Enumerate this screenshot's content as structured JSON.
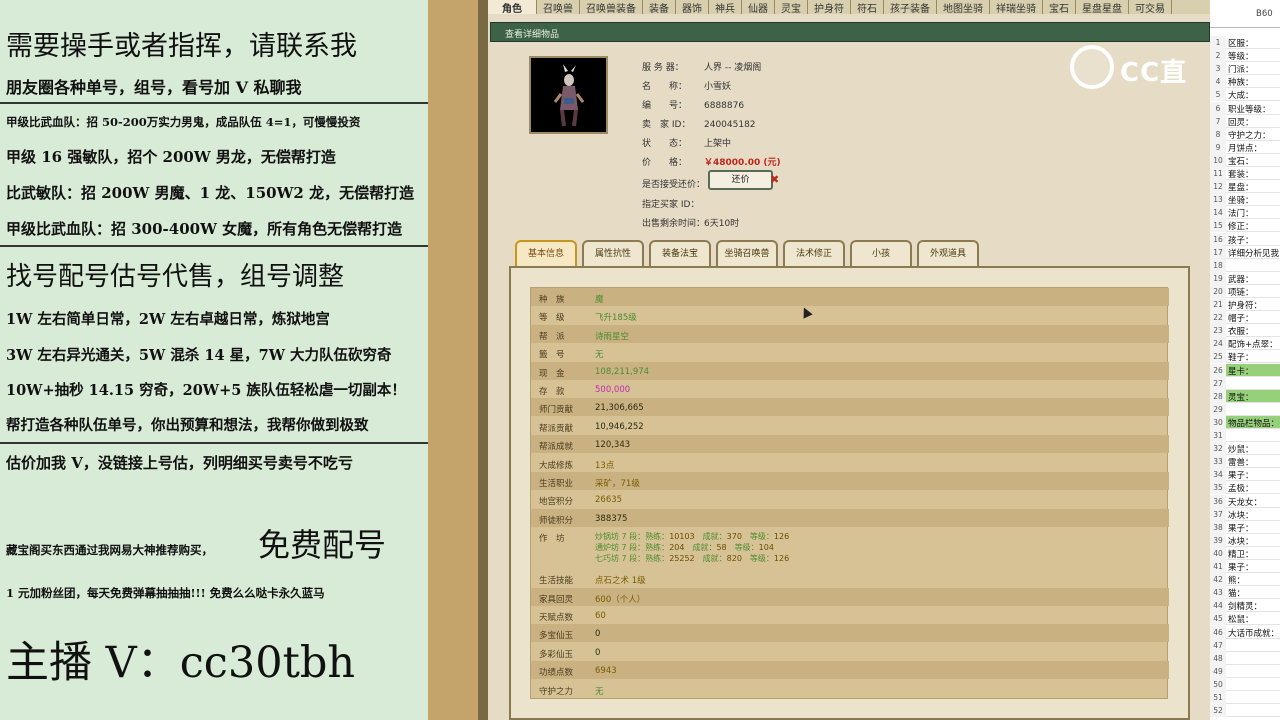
{
  "left_panel": {
    "lines": [
      "需要操手或者指挥，请联系我",
      "朋友圈各种单号，组号，看号加 V 私聊我",
      "甲级比武血队：招 50-200万实力男鬼，成品队伍 4=1，可慢慢投资",
      "甲级 16 强敏队，招个 200W 男龙，无偿帮打造",
      "比武敏队：招 200W 男魔、1 龙、150W2 龙，无偿帮打造",
      "甲级比武血队：招 300-400W 女魔，所有角色无偿帮打造",
      "找号配号估号代售，组号调整",
      "1W 左右简单日常，2W 左右卓越日常，炼狱地宫",
      "3W 左右异光通关，5W 混杀 14 星，7W 大力队伍砍穷奇",
      "10W+抽秒 14.15 穷奇，20W+5 族队伍轻松虐一切副本！",
      "帮打造各种队伍单号，你出预算和想法，我帮你做到极致",
      "估价加我 V，没链接上号估，列明细买号卖号不吃亏",
      "藏宝阁买东西通过我网易大神推荐购买，",
      "免费配号",
      "1 元加粉丝团，每天免费弹幕抽抽抽!!! 免费么么哒卡永久蓝马",
      "主播 V：cc30tbh"
    ]
  },
  "game": {
    "top_tabs": [
      "角色",
      "召唤兽",
      "召唤兽装备",
      "装备",
      "器饰",
      "神兵",
      "仙器",
      "灵宝",
      "护身符",
      "符石",
      "孩子装备",
      "地图坐骑",
      "祥瑞坐骑",
      "宝石",
      "星盘星盘",
      "可交易"
    ],
    "header": "查看详细物品",
    "item": {
      "labels": [
        "服 务 器：",
        "名　　称：",
        "编　　号：",
        "卖　家 ID：",
        "状　　态：",
        "价　　格：",
        "是否接受还价：",
        "指定买家 ID：",
        "出售剩余时间："
      ],
      "values": [
        "人界 -- 凌烟阁",
        "小雪妖",
        "6888876",
        "240045182",
        "上架中",
        "￥48000.00 (元)",
        "",
        "",
        "6天10时"
      ],
      "haggle_button": "还价",
      "haggle_x": "✖"
    },
    "detail_tabs": [
      "基本信息",
      "属性抗性",
      "装备法宝",
      "坐骑召唤兽",
      "法术修正",
      "小孩",
      "外观道具"
    ],
    "rows": [
      {
        "k": "种　族",
        "v": "魔",
        "c": "green"
      },
      {
        "k": "等　级",
        "v": "飞升185级",
        "c": "green"
      },
      {
        "k": "帮　派",
        "v": "诗雨星空",
        "c": "green"
      },
      {
        "k": "籤　号",
        "v": "无",
        "c": "green"
      },
      {
        "k": "现　金",
        "v": "108,211,974",
        "c": "green"
      },
      {
        "k": "存　款",
        "v": "500,000",
        "c": "magenta"
      },
      {
        "k": "师门贡献",
        "v": "21,306,665",
        "c": ""
      },
      {
        "k": "帮派贡献",
        "v": "10,946,252",
        "c": ""
      },
      {
        "k": "帮派成就",
        "v": "120,343",
        "c": ""
      },
      {
        "k": "大成修炼",
        "v": "13点",
        "c": "gold"
      },
      {
        "k": "生活职业",
        "v": "采矿，71级",
        "c": "gold"
      },
      {
        "k": "地宫积分",
        "v": "26635",
        "c": "gold"
      },
      {
        "k": "师徒积分",
        "v": "388375",
        "c": ""
      }
    ],
    "craft_label": "作　坊",
    "craft_lines": [
      {
        "name": "炒锅坊 7 段：",
        "a": "熟练：",
        "av": "10103",
        "b": "成就：",
        "bv": "370",
        "c": "等级：",
        "cv": "126"
      },
      {
        "name": "通炉坊 7 段：",
        "a": "熟练：",
        "av": "204",
        "b": "成就：",
        "bv": "58",
        "c": "等级：",
        "cv": "104"
      },
      {
        "name": "七巧坊 7 段：",
        "a": "熟练：",
        "av": "25252",
        "b": "成就：",
        "bv": "820",
        "c": "等级：",
        "cv": "126"
      }
    ],
    "rows2": [
      {
        "k": "生活技能",
        "v": "点石之术 1级",
        "c": "gold"
      },
      {
        "k": "家具回灵",
        "v": "600（个人）",
        "c": "gold"
      },
      {
        "k": "天赋点数",
        "v": "60",
        "c": "gold"
      },
      {
        "k": "多宝仙玉",
        "v": "0",
        "c": ""
      },
      {
        "k": "多彩仙玉",
        "v": "0",
        "c": ""
      },
      {
        "k": "功绩点数",
        "v": "6943",
        "c": "gold"
      },
      {
        "k": "守护之力",
        "v": "无",
        "c": "green"
      }
    ]
  },
  "logo": {
    "text": "CC直"
  },
  "sheet": {
    "cell_ref": "B60",
    "rows": [
      {
        "n": "1",
        "l": "区服："
      },
      {
        "n": "2",
        "l": "等级："
      },
      {
        "n": "3",
        "l": "门派："
      },
      {
        "n": "4",
        "l": "种族："
      },
      {
        "n": "5",
        "l": "大成："
      },
      {
        "n": "6",
        "l": "职业等级："
      },
      {
        "n": "7",
        "l": "回灵："
      },
      {
        "n": "8",
        "l": "守护之力："
      },
      {
        "n": "9",
        "l": "月饼点："
      },
      {
        "n": "10",
        "l": "宝石："
      },
      {
        "n": "11",
        "l": "套装："
      },
      {
        "n": "12",
        "l": "星盘："
      },
      {
        "n": "13",
        "l": "坐骑："
      },
      {
        "n": "14",
        "l": "法门："
      },
      {
        "n": "15",
        "l": "修正："
      },
      {
        "n": "16",
        "l": "孩子："
      },
      {
        "n": "17",
        "l": "详细分析见我"
      },
      {
        "n": "18",
        "l": ""
      },
      {
        "n": "19",
        "l": "武器："
      },
      {
        "n": "20",
        "l": "项链："
      },
      {
        "n": "21",
        "l": "护身符："
      },
      {
        "n": "22",
        "l": "帽子："
      },
      {
        "n": "23",
        "l": "衣服："
      },
      {
        "n": "24",
        "l": "配饰+点翠："
      },
      {
        "n": "25",
        "l": "鞋子："
      },
      {
        "n": "26",
        "l": "星卡：",
        "hl": true
      },
      {
        "n": "27",
        "l": ""
      },
      {
        "n": "28",
        "l": "灵宝：",
        "hl": true
      },
      {
        "n": "29",
        "l": ""
      },
      {
        "n": "30",
        "l": "物品栏物品：",
        "hl": true
      },
      {
        "n": "31",
        "l": ""
      },
      {
        "n": "32",
        "l": "炒鼠："
      },
      {
        "n": "33",
        "l": "雷兽："
      },
      {
        "n": "34",
        "l": "果子："
      },
      {
        "n": "35",
        "l": "孟极："
      },
      {
        "n": "36",
        "l": "天龙女："
      },
      {
        "n": "37",
        "l": "冰块："
      },
      {
        "n": "38",
        "l": "果子："
      },
      {
        "n": "39",
        "l": "冰块："
      },
      {
        "n": "40",
        "l": "精卫："
      },
      {
        "n": "41",
        "l": "果子："
      },
      {
        "n": "42",
        "l": "熊："
      },
      {
        "n": "43",
        "l": "猫："
      },
      {
        "n": "44",
        "l": "剑精灵："
      },
      {
        "n": "45",
        "l": "松鼠："
      },
      {
        "n": "46",
        "l": "大话币成就："
      },
      {
        "n": "47",
        "l": ""
      },
      {
        "n": "48",
        "l": ""
      },
      {
        "n": "49",
        "l": ""
      },
      {
        "n": "50",
        "l": ""
      },
      {
        "n": "51",
        "l": ""
      },
      {
        "n": "52",
        "l": ""
      }
    ]
  }
}
